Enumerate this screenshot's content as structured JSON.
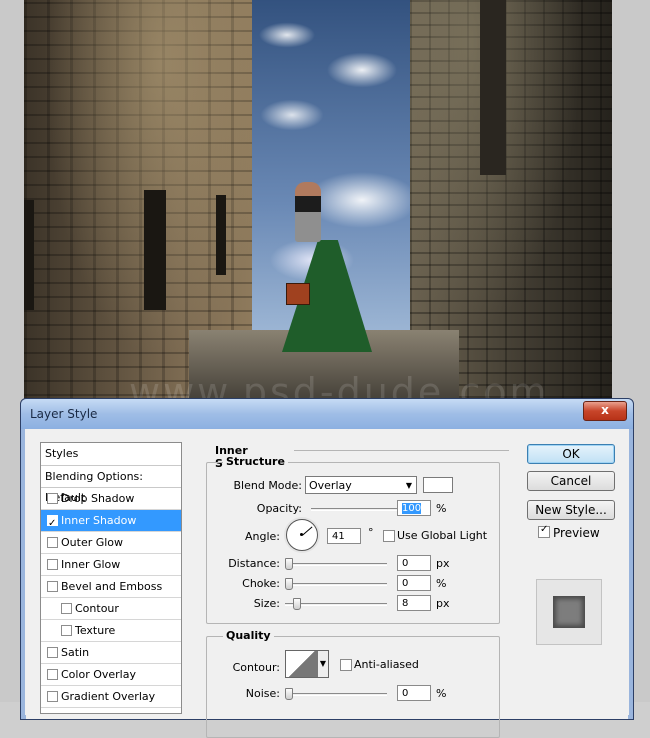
{
  "photo": {
    "watermark": "www.psd-dude.com"
  },
  "dialog": {
    "title": "Layer Style",
    "close_glyph": "x",
    "styles_header": "Styles",
    "blending_options": "Blending Options: Default",
    "styles": [
      {
        "label": "Drop Shadow",
        "checked": false
      },
      {
        "label": "Inner Shadow",
        "checked": true
      },
      {
        "label": "Outer Glow",
        "checked": false
      },
      {
        "label": "Inner Glow",
        "checked": false
      },
      {
        "label": "Bevel and Emboss",
        "checked": false
      },
      {
        "label": "Contour",
        "checked": false
      },
      {
        "label": "Texture",
        "checked": false
      },
      {
        "label": "Satin",
        "checked": false
      },
      {
        "label": "Color Overlay",
        "checked": false
      },
      {
        "label": "Gradient Overlay",
        "checked": false
      }
    ],
    "section_title": "Inner Shadow",
    "structure": {
      "title": "Structure",
      "blend_mode_label": "Blend Mode:",
      "blend_mode_value": "Overlay",
      "shadow_color": "#ffffff",
      "opacity_label": "Opacity:",
      "opacity_value": "100",
      "opacity_unit": "%",
      "angle_label": "Angle:",
      "angle_value": "41",
      "angle_unit": "°",
      "use_global_light_label": "Use Global Light",
      "use_global_light": false,
      "distance_label": "Distance:",
      "distance_value": "0",
      "distance_unit": "px",
      "choke_label": "Choke:",
      "choke_value": "0",
      "choke_unit": "%",
      "size_label": "Size:",
      "size_value": "8",
      "size_unit": "px"
    },
    "quality": {
      "title": "Quality",
      "contour_label": "Contour:",
      "anti_aliased_label": "Anti-aliased",
      "anti_aliased": false,
      "noise_label": "Noise:",
      "noise_value": "0",
      "noise_unit": "%"
    },
    "buttons": {
      "ok": "OK",
      "cancel": "Cancel",
      "new_style": "New Style...",
      "preview_label": "Preview",
      "preview_checked": true
    }
  }
}
